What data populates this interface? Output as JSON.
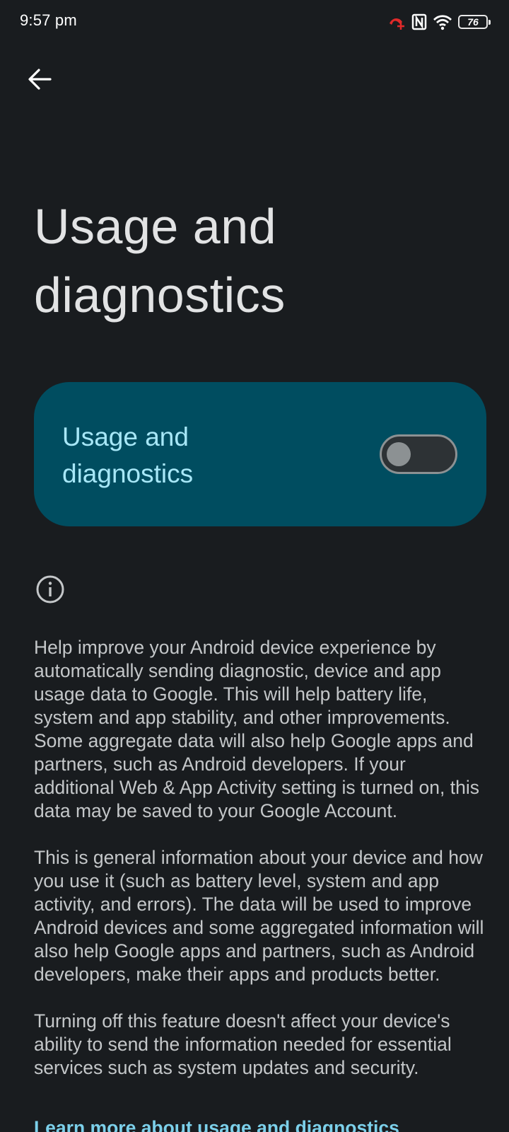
{
  "status_bar": {
    "time": "9:57 pm",
    "battery_level": "76",
    "icons": [
      "call-forwarding-icon",
      "nfc-icon",
      "wifi-icon",
      "battery-icon"
    ],
    "call_icon_color": "#e02a2a"
  },
  "header": {
    "back_icon": "arrow-back-icon",
    "title": "Usage and diagnostics"
  },
  "main_switch": {
    "label": "Usage and diagnostics",
    "enabled": false,
    "card_color": "#004d60",
    "label_color": "#a7e7f7"
  },
  "info": {
    "icon": "info-icon",
    "paragraphs": [
      "Help improve your Android device experience by automatically sending diagnostic, device and app usage data to Google. This will help battery life, system and app stability, and other improvements. Some aggregate data will also help Google apps and partners, such as Android developers. If your additional Web & App Activity setting is turned on, this data may be saved to your Google Account.",
      "This is general information about your device and how you use it (such as battery level, system and app activity, and errors). The data will be used to improve Android devices and some aggregated information will also help Google apps and partners, such as Android developers, make their apps and products better.",
      "Turning off this feature doesn't affect your device's ability to send the information needed for essential services such as system updates and security."
    ],
    "learn_more_link": "Learn more about usage and diagnostics"
  },
  "colors": {
    "background": "#191c1f",
    "link": "#7cd0ea"
  }
}
